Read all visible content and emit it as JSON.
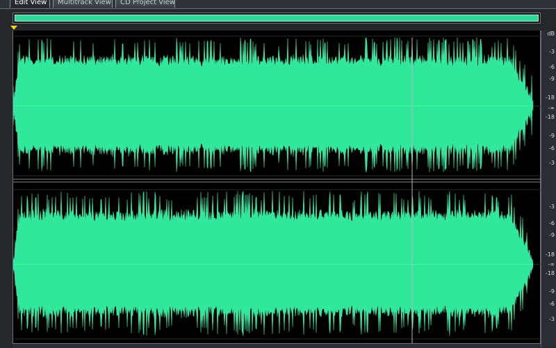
{
  "tabs": [
    {
      "label": "Edit View",
      "active": true
    },
    {
      "label": "Multitrack View",
      "active": false
    },
    {
      "label": "CD Project View",
      "active": false
    }
  ],
  "scale": {
    "unit": "dB",
    "top_channel": [
      "dB",
      "-3",
      "-6",
      "-9",
      "-18",
      "-∞",
      "-18",
      "-9",
      "-6",
      "-3"
    ],
    "bottom_channel": [
      "-3",
      "-6",
      "-9",
      "-18",
      "-∞",
      "-18",
      "-9",
      "-6",
      "-3"
    ]
  },
  "colors": {
    "waveform": "#2fe89c",
    "background": "#000000",
    "scale_background": "#2a2d31",
    "cursor_marker": "#f4d20e"
  }
}
